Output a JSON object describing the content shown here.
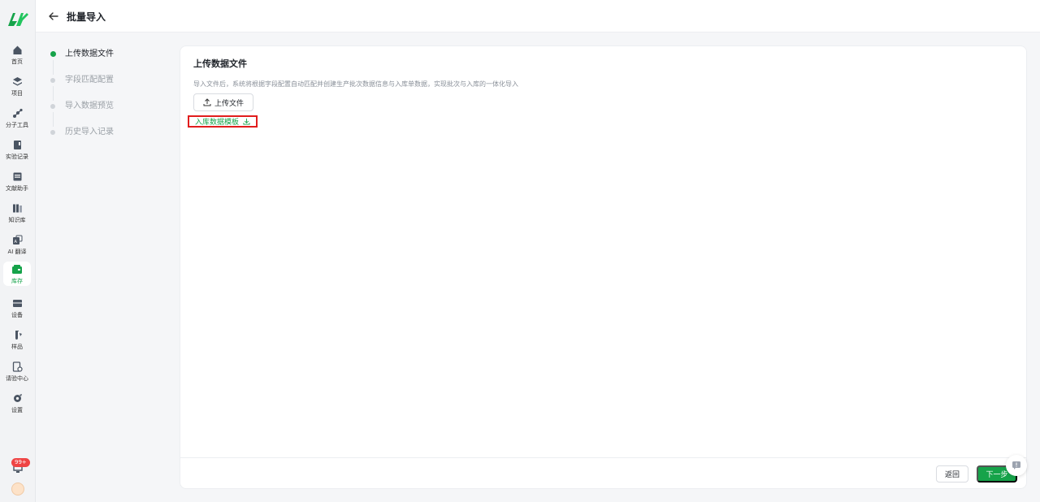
{
  "header": {
    "title": "批量导入"
  },
  "nav": {
    "items": [
      {
        "label": "首页",
        "icon": "home-icon"
      },
      {
        "label": "项目",
        "icon": "layers-icon"
      },
      {
        "label": "分子工具",
        "icon": "molecule-icon"
      },
      {
        "label": "实验记录",
        "icon": "notebook-icon"
      },
      {
        "label": "文献助手",
        "icon": "document-icon"
      },
      {
        "label": "知识库",
        "icon": "books-icon"
      },
      {
        "label": "AI 翻译",
        "icon": "translate-icon"
      },
      {
        "label": "库存",
        "icon": "inventory-icon"
      },
      {
        "label": "设备",
        "icon": "device-icon"
      },
      {
        "label": "样品",
        "icon": "sample-icon"
      },
      {
        "label": "请验中心",
        "icon": "inspection-icon"
      },
      {
        "label": "设置",
        "icon": "settings-icon"
      }
    ],
    "active_index": 7,
    "notification_badge": "99+"
  },
  "steps": [
    {
      "label": "上传数据文件",
      "active": true
    },
    {
      "label": "字段匹配配置",
      "active": false
    },
    {
      "label": "导入数据预览",
      "active": false
    },
    {
      "label": "历史导入记录",
      "active": false
    }
  ],
  "card": {
    "title": "上传数据文件",
    "description": "导入文件后，系统将根据字段配置自动匹配并创建生产批次数据信息与入库单数据，实现批次与入库的一体化导入",
    "upload_label": "上传文件",
    "template_label": "入库数据模板"
  },
  "footer": {
    "back_label": "返回",
    "next_label": "下一步"
  },
  "colors": {
    "accent": "#16a34a",
    "highlight": "#e11d1d"
  }
}
